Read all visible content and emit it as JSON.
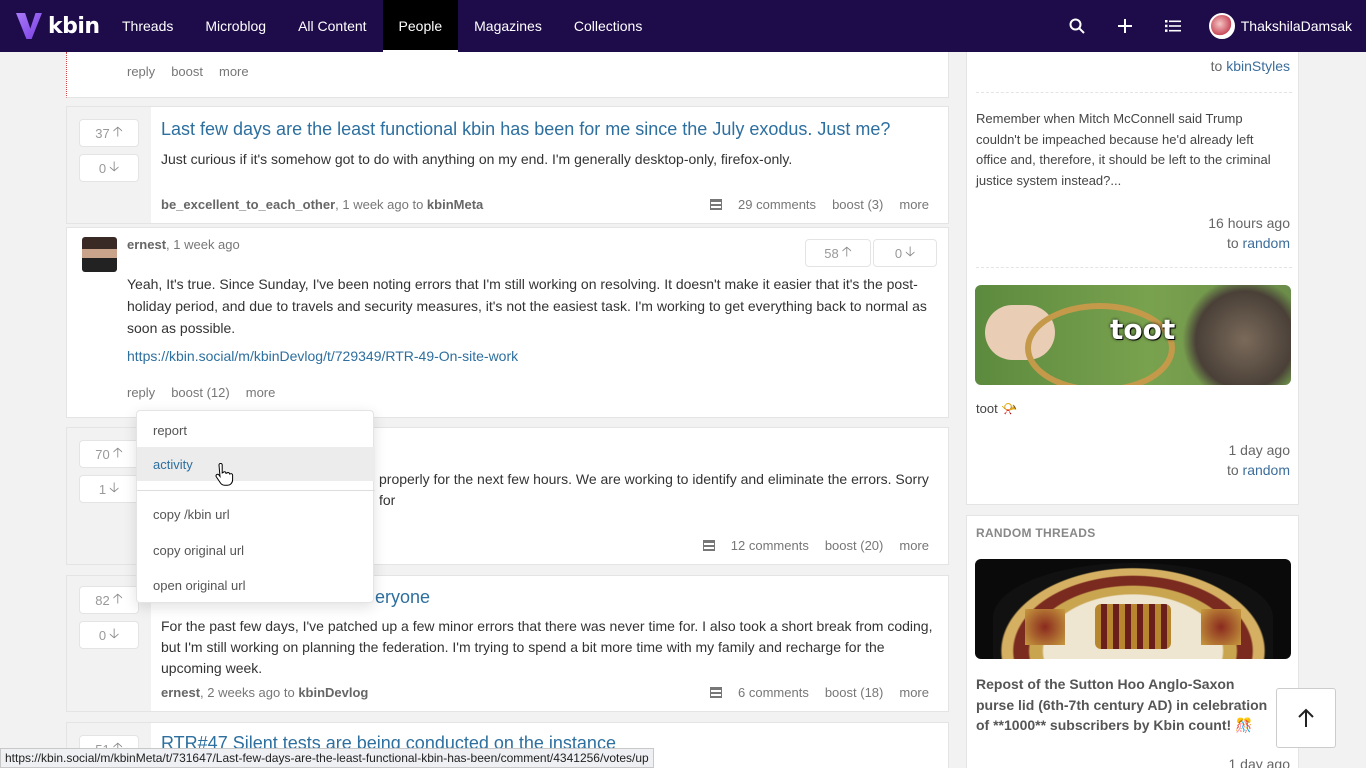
{
  "brand": {
    "name": "kbin"
  },
  "nav": {
    "items": [
      "Threads",
      "Microblog",
      "All Content",
      "People",
      "Magazines",
      "Collections"
    ],
    "active": "People",
    "user": "ThakshilaDamsak"
  },
  "top_partial": {
    "reply": "reply",
    "boost": "boost",
    "more": "more"
  },
  "thread1": {
    "up": "37",
    "down": "0",
    "title": "Last few days are the least functional kbin has been for me since the July exodus. Just me?",
    "body": "Just curious if it's somehow got to do with anything on my end. I'm generally desktop-only, firefox-only.",
    "author": "be_excellent_to_each_other",
    "time": ", 1 week ago to ",
    "magazine": "kbinMeta",
    "comments": "29 comments",
    "boost": "boost (3)",
    "more": "more"
  },
  "comment1": {
    "author": "ernest",
    "time": ", 1 week ago",
    "up": "58",
    "down": "0",
    "body": "Yeah, It's true. Since Sunday, I've been noting errors that I'm still working on resolving. It doesn't make it easier that it's the post-holiday period, and due to travels and security measures, it's not the easiest task. I'm working to get everything back to normal as soon as possible.",
    "link": "https://kbin.social/m/kbinDevlog/t/729349/RTR-49-On-site-work",
    "reply": "reply",
    "boost": "boost (12)",
    "more": "more"
  },
  "thread2": {
    "up": "70",
    "down": "1",
    "body_visible": "properly for the next few hours. We are working to identify and eliminate the errors. Sorry for",
    "comments": "12 comments",
    "boost": "boost (20)",
    "more": "more"
  },
  "dropdown": {
    "items": [
      "report",
      "activity",
      "copy /kbin url",
      "copy original url",
      "open original url"
    ]
  },
  "thread3": {
    "up": "82",
    "down": "0",
    "title_visible": "eryone",
    "body": "For the past few days, I've patched up a few minor errors that there was never time for. I also took a short break from coding, but I'm still working on planning the federation. I'm trying to spend a bit more time with my family and recharge for the upcoming week.",
    "author": "ernest",
    "time": ", 2 weeks ago to ",
    "magazine": "kbinDevlog",
    "comments": "6 comments",
    "boost": "boost (18)",
    "more": "more"
  },
  "thread4": {
    "up": "51",
    "title": "RTR#47 Silent tests are being conducted on the instance"
  },
  "sidebar": {
    "top_to": "to ",
    "top_mag": "kbinStyles",
    "post1": {
      "text": "Remember when Mitch McConnell said Trump couldn't be impeached because he'd already left office and, therefore, it should be left to the criminal justice system instead?...",
      "time": "16 hours ago",
      "to": "to ",
      "mag": "random"
    },
    "post2": {
      "image_text": "toot",
      "text": "toot 📯",
      "time": "1 day ago",
      "to": "to ",
      "mag": "random"
    },
    "random_threads": {
      "heading": "RANDOM THREADS",
      "title": "Repost of the Sutton Hoo Anglo-Saxon purse lid (6th-7th century AD) in celebration of **1000** subscribers by Kbin count! 🎊",
      "time": "1 day ago"
    }
  },
  "status_url": "https://kbin.social/m/kbinMeta/t/731647/Last-few-days-are-the-least-functional-kbin-has-been/comment/4341256/votes/up",
  "colors": {
    "nav_bg": "#1e0b4a",
    "link": "#2d6f9f",
    "page_bg": "#f2f2f2"
  }
}
